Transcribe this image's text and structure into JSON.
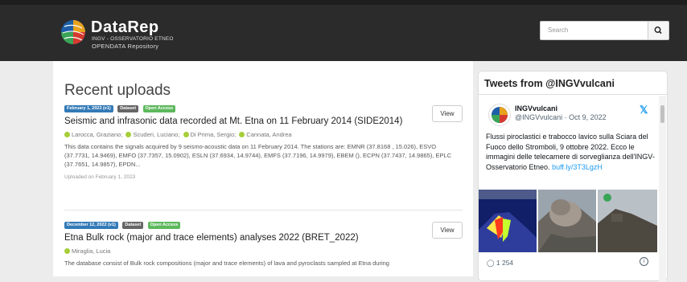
{
  "header": {
    "brand": "DataRep",
    "subtitle1": "INGV - OSSERVATORIO ETNEO",
    "subtitle2": "OPENDATA Repository",
    "search_placeholder": "Search",
    "search_icon": "magnifier-icon"
  },
  "main": {
    "title": "Recent uploads",
    "records": [
      {
        "date_badge": "February 1, 2023 (v1)",
        "type_badge": "Dataset",
        "access_badge": "Open Access",
        "title": "Seismic and infrasonic data recorded at Mt. Etna on 11 February 2014 (SIDE2014)",
        "authors": [
          "Larocca, Graziano;",
          "Scuderi, Luciano;",
          "Di Prima, Sergio;",
          "Cannata, Andrea"
        ],
        "description": "This data contains the signals acquired by 9 seismo-acoustic data on 11 February 2014. The stations are: EMNR (37.8168 , 15.026), ESVO (37.7731, 14.9469), EMFO (37.7357, 15.0902), ESLN (37.6934, 14.9744), EMFS (37.7196, 14.9979), EBEM (), ECPN (37.7437, 14.9865), EPLC (37.7651, 14.9857), EPDN...",
        "uploaded": "Uploaded on February 1, 2023",
        "view_label": "View"
      },
      {
        "date_badge": "December 12, 2022 (v1)",
        "type_badge": "Dataset",
        "access_badge": "Open Access",
        "title": "Etna Bulk rock (major and trace elements) analyses 2022 (BRET_2022)",
        "authors": [
          "Miraglia, Lucia"
        ],
        "description": "The database consist of Bulk rock compositions (major and trace elements) of lava and pyroclasts sampled at Etna during",
        "view_label": "View"
      }
    ]
  },
  "tweets": {
    "heading": "Tweets from @INGVvulcani",
    "tweet": {
      "name": "INGVvulcani",
      "handle": "@INGVvulcani · Oct 9, 2022",
      "text": "Flussi piroclastici e trabocco lavico sulla Sciara del Fuoco dello Stromboli, 9 ottobre 2022. Ecco le immagini delle telecamere di sorveglianza dell'INGV-Osservatorio Etneo.",
      "link": "buff.ly/3T3LgzH",
      "actions": "1  254",
      "info": "i"
    }
  },
  "colors": {
    "header_bg": "#2b2b2b",
    "badge_date": "#337ab7",
    "badge_type": "#666666",
    "badge_open": "#5cb85c",
    "twitter_blue": "#1d9bf0"
  }
}
